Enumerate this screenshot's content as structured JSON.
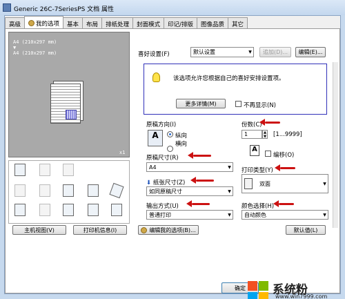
{
  "window": {
    "title": "Generic 26C-7SeriesPS 文档 属性"
  },
  "tabs": [
    "高级",
    "我的选项",
    "基本",
    "布局",
    "排纸处理",
    "封面模式",
    "印记/排版",
    "图像品质",
    "其它"
  ],
  "preview": {
    "size_line1": "A4 (210x297 mm)",
    "arrow": "▼",
    "size_line2": "A4 (210x297 mm)",
    "copies": "x1"
  },
  "bottom_left": {
    "main_view": "主机视图(V)",
    "printer_info": "打印机信息(I)"
  },
  "favorites": {
    "label": "喜好设置(F)",
    "value": "默认设置",
    "add": "追加(D)...",
    "edit": "编辑(E)..."
  },
  "info": {
    "text": "该选项允许您根据自己的喜好安排设置项。",
    "more": "更多详情(M)",
    "no_show": "不再显示(N)"
  },
  "orientation": {
    "label": "原稿方向(I)",
    "portrait": "纵向",
    "landscape": "横向"
  },
  "original_size": {
    "label": "原稿尺寸(R)",
    "value": "A4"
  },
  "paper_size": {
    "label": "纸张尺寸(Z)",
    "value": "如同原稿尺寸"
  },
  "output": {
    "label": "输出方式(U)",
    "value": "普通打印"
  },
  "copies": {
    "label": "份数(C)",
    "value": "1",
    "range": "[1...9999]"
  },
  "collate": {
    "label": "编移(O)"
  },
  "print_type": {
    "label": "打印类型(Y)",
    "value": "双面"
  },
  "color": {
    "label": "颜色选择(H)",
    "value": "自动颜色"
  },
  "edit_my_options": "编辑我的选项(B)...",
  "defaults": "默认值(L)",
  "ok": "确定",
  "watermark": {
    "brand": "系统粉",
    "url": "www.win7999.com"
  }
}
